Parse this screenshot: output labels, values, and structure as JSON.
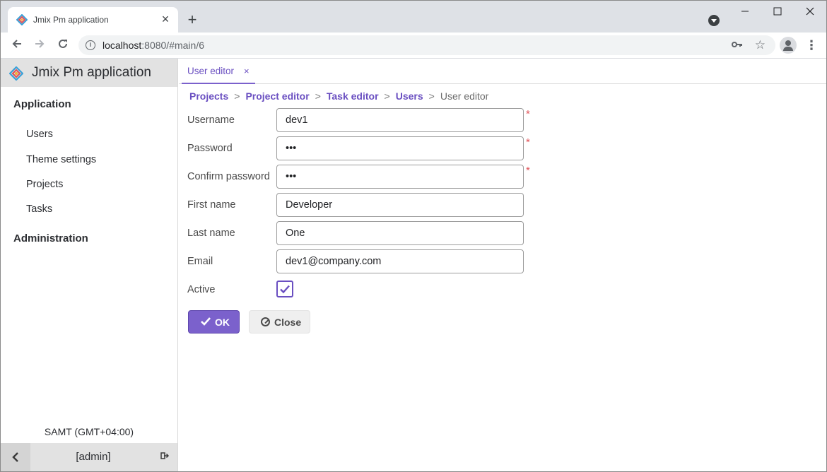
{
  "browser": {
    "tab_title": "Jmix Pm application",
    "tab_close": "×",
    "new_tab": "+",
    "url_host": "localhost",
    "url_path": ":8080/#main/6"
  },
  "app": {
    "title": "Jmix Pm application",
    "brand_colors": [
      "#e0545a",
      "#3aa0d8",
      "#f2b134",
      "#7b61cc"
    ]
  },
  "sidebar": {
    "groups": [
      {
        "label": "Application",
        "items": [
          "Users",
          "Theme settings",
          "Projects",
          "Tasks"
        ]
      },
      {
        "label": "Administration",
        "items": []
      }
    ],
    "timezone": "SAMT (GMT+04:00)",
    "user": "[admin]"
  },
  "tabs": [
    {
      "label": "User editor",
      "close": "×",
      "active": true
    }
  ],
  "breadcrumb": {
    "links": [
      "Projects",
      "Project editor",
      "Task editor",
      "Users"
    ],
    "separator": ">",
    "current": "User editor"
  },
  "form": {
    "fields": [
      {
        "label": "Username",
        "value": "dev1",
        "required": true
      },
      {
        "label": "Password",
        "value": "•••",
        "required": true
      },
      {
        "label": "Confirm password",
        "value": "•••",
        "required": true
      },
      {
        "label": "First name",
        "value": "Developer",
        "required": false
      },
      {
        "label": "Last name",
        "value": "One",
        "required": false
      },
      {
        "label": "Email",
        "value": "dev1@company.com",
        "required": false
      }
    ],
    "active_label": "Active",
    "active_checked": true,
    "required_mark": "*"
  },
  "buttons": {
    "ok": "OK",
    "close": "Close"
  },
  "colors": {
    "accent": "#7b61cc",
    "required": "#e0545a"
  }
}
